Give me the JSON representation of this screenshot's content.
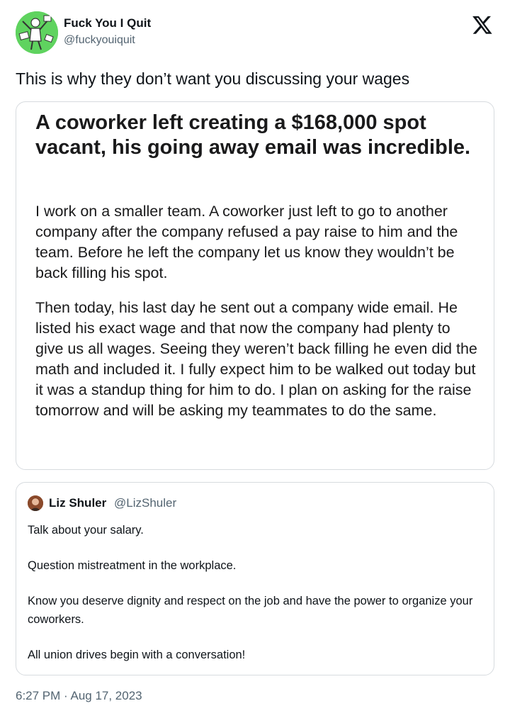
{
  "author": {
    "display_name": "Fuck You I Quit",
    "handle": "@fuckyouiquit",
    "avatar_icon": "cartoon-figure-icon",
    "avatar_color": "#5fd35f"
  },
  "tweet": {
    "text": "This is why they don’t want you discussing your wages",
    "timestamp": "6:27 PM · Aug 17, 2023"
  },
  "embedded_post": {
    "title": "A coworker left creating a $168,000 spot vacant, his going away email was incredible.",
    "paragraphs": [
      "I work on a smaller team.  A coworker just left to go to another company after the company refused a pay raise to him and the team.  Before he left the company let us know they wouldn’t be back filling his spot.",
      "Then today, his last day he sent out a company wide email.  He listed his exact wage and that now the company had plenty to give us all wages.  Seeing they weren’t back filling he even did the math and included it.  I fully expect him to be walked out today but it was a standup thing for him to do.  I plan on asking for the raise tomorrow and will be asking my teammates to do the same."
    ]
  },
  "quoted_tweet": {
    "display_name": "Liz Shuler",
    "handle": "@LizShuler",
    "paragraphs": [
      "Talk about your salary.",
      "Question mistreatment in the workplace.",
      "Know you deserve dignity and respect on the job and have the power to organize your coworkers.",
      "All union drives begin with a conversation!"
    ]
  },
  "icons": {
    "brand": "x-logo-icon",
    "quoted_avatar": "avatar-icon"
  }
}
